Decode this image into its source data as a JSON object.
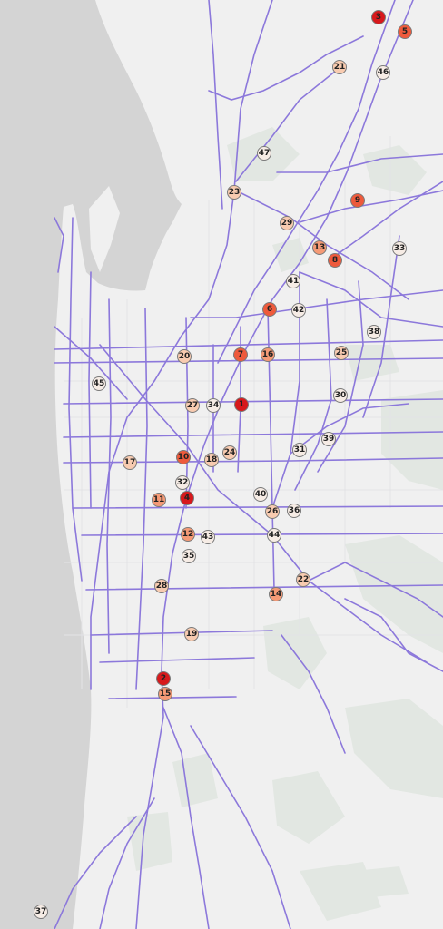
{
  "colors": {
    "sea": "#d4d4d4",
    "land": "#f0f0f0",
    "park": "#e2e7e2",
    "road": "#8c78db",
    "minor_road": "#e3e3e6",
    "marker_border": "#7a7a7a",
    "rank_scale": {
      "top": "#d7191c",
      "high": "#ee5a3c",
      "mid": "#f59a76",
      "low": "#f8cbb0",
      "lowest": "#f6ece5"
    }
  },
  "markers": [
    {
      "id": "1",
      "label": "1",
      "level": "top"
    },
    {
      "id": "2",
      "label": "2",
      "level": "top"
    },
    {
      "id": "3",
      "label": "3",
      "level": "top"
    },
    {
      "id": "4",
      "label": "4",
      "level": "top"
    },
    {
      "id": "5",
      "label": "5",
      "level": "high"
    },
    {
      "id": "6",
      "label": "6",
      "level": "high"
    },
    {
      "id": "7",
      "label": "7",
      "level": "high"
    },
    {
      "id": "8",
      "label": "8",
      "level": "high"
    },
    {
      "id": "9",
      "label": "9",
      "level": "high"
    },
    {
      "id": "10",
      "label": "10",
      "level": "high"
    },
    {
      "id": "11",
      "label": "11",
      "level": "mid"
    },
    {
      "id": "12",
      "label": "12",
      "level": "mid"
    },
    {
      "id": "13",
      "label": "13",
      "level": "mid"
    },
    {
      "id": "14",
      "label": "14",
      "level": "mid"
    },
    {
      "id": "15",
      "label": "15",
      "level": "mid"
    },
    {
      "id": "16",
      "label": "16",
      "level": "mid"
    },
    {
      "id": "17",
      "label": "17",
      "level": "low"
    },
    {
      "id": "18",
      "label": "18",
      "level": "low"
    },
    {
      "id": "19",
      "label": "19",
      "level": "low"
    },
    {
      "id": "20",
      "label": "20",
      "level": "low"
    },
    {
      "id": "21",
      "label": "21",
      "level": "low"
    },
    {
      "id": "22",
      "label": "22",
      "level": "low"
    },
    {
      "id": "23",
      "label": "23",
      "level": "low"
    },
    {
      "id": "24",
      "label": "24",
      "level": "low"
    },
    {
      "id": "25",
      "label": "25",
      "level": "low"
    },
    {
      "id": "26",
      "label": "26",
      "level": "low"
    },
    {
      "id": "27",
      "label": "27",
      "level": "low"
    },
    {
      "id": "28",
      "label": "28",
      "level": "low"
    },
    {
      "id": "29",
      "label": "29",
      "level": "low"
    },
    {
      "id": "30",
      "label": "30",
      "level": "lowest"
    },
    {
      "id": "31",
      "label": "31",
      "level": "lowest"
    },
    {
      "id": "32",
      "label": "32",
      "level": "lowest"
    },
    {
      "id": "33",
      "label": "33",
      "level": "lowest"
    },
    {
      "id": "34",
      "label": "34",
      "level": "lowest"
    },
    {
      "id": "35",
      "label": "35",
      "level": "lowest"
    },
    {
      "id": "36",
      "label": "36",
      "level": "lowest"
    },
    {
      "id": "37",
      "label": "37",
      "level": "lowest"
    },
    {
      "id": "38",
      "label": "38",
      "level": "lowest"
    },
    {
      "id": "39",
      "label": "39",
      "level": "lowest"
    },
    {
      "id": "40",
      "label": "40",
      "level": "lowest"
    },
    {
      "id": "41",
      "label": "41",
      "level": "lowest"
    },
    {
      "id": "42",
      "label": "42",
      "level": "lowest"
    },
    {
      "id": "43",
      "label": "43",
      "level": "lowest"
    },
    {
      "id": "44",
      "label": "44",
      "level": "lowest"
    },
    {
      "id": "45",
      "label": "45",
      "level": "lowest"
    },
    {
      "id": "46",
      "label": "46",
      "level": "lowest"
    },
    {
      "id": "47",
      "label": "47",
      "level": "lowest"
    }
  ]
}
